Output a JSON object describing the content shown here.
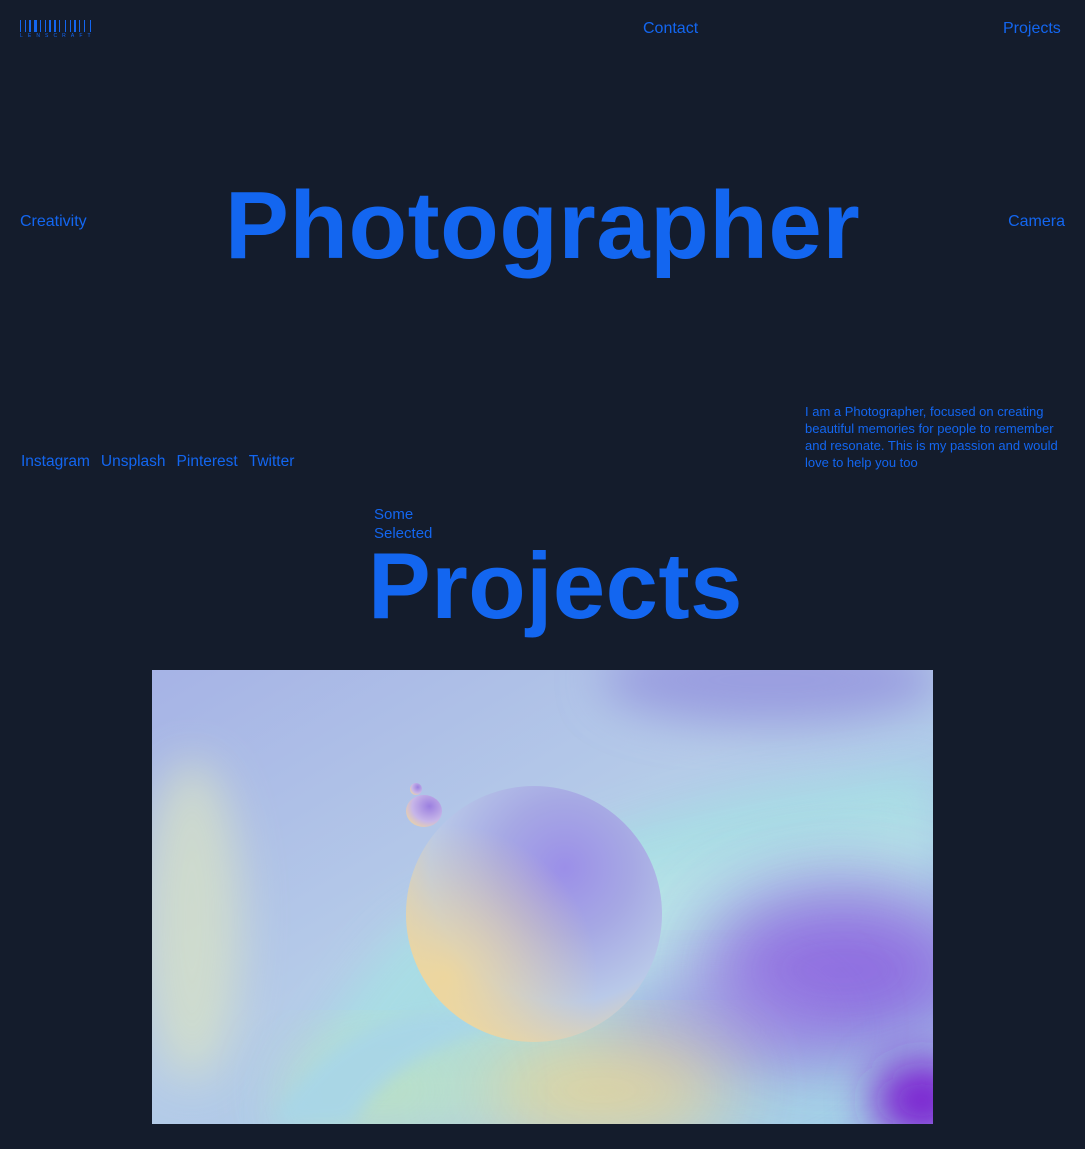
{
  "logo": {
    "text": "LENSCRAFT",
    "color": "#1366f0"
  },
  "nav": {
    "contact": "Contact",
    "projects": "Projects"
  },
  "hero": {
    "left_word": "Creativity",
    "title": "Photographer",
    "right_word": "Camera"
  },
  "socials": [
    "Instagram",
    "Unsplash",
    "Pinterest",
    "Twitter"
  ],
  "bio": "I am a Photographer, focused on creating beautiful memories for people to remember and resonate. This is my passion and would  love to help you too",
  "projects": {
    "kicker_line1": "Some",
    "kicker_line2": "Selected",
    "title": "Projects"
  },
  "colors": {
    "background": "#141c2c",
    "accent": "#1366f0"
  }
}
